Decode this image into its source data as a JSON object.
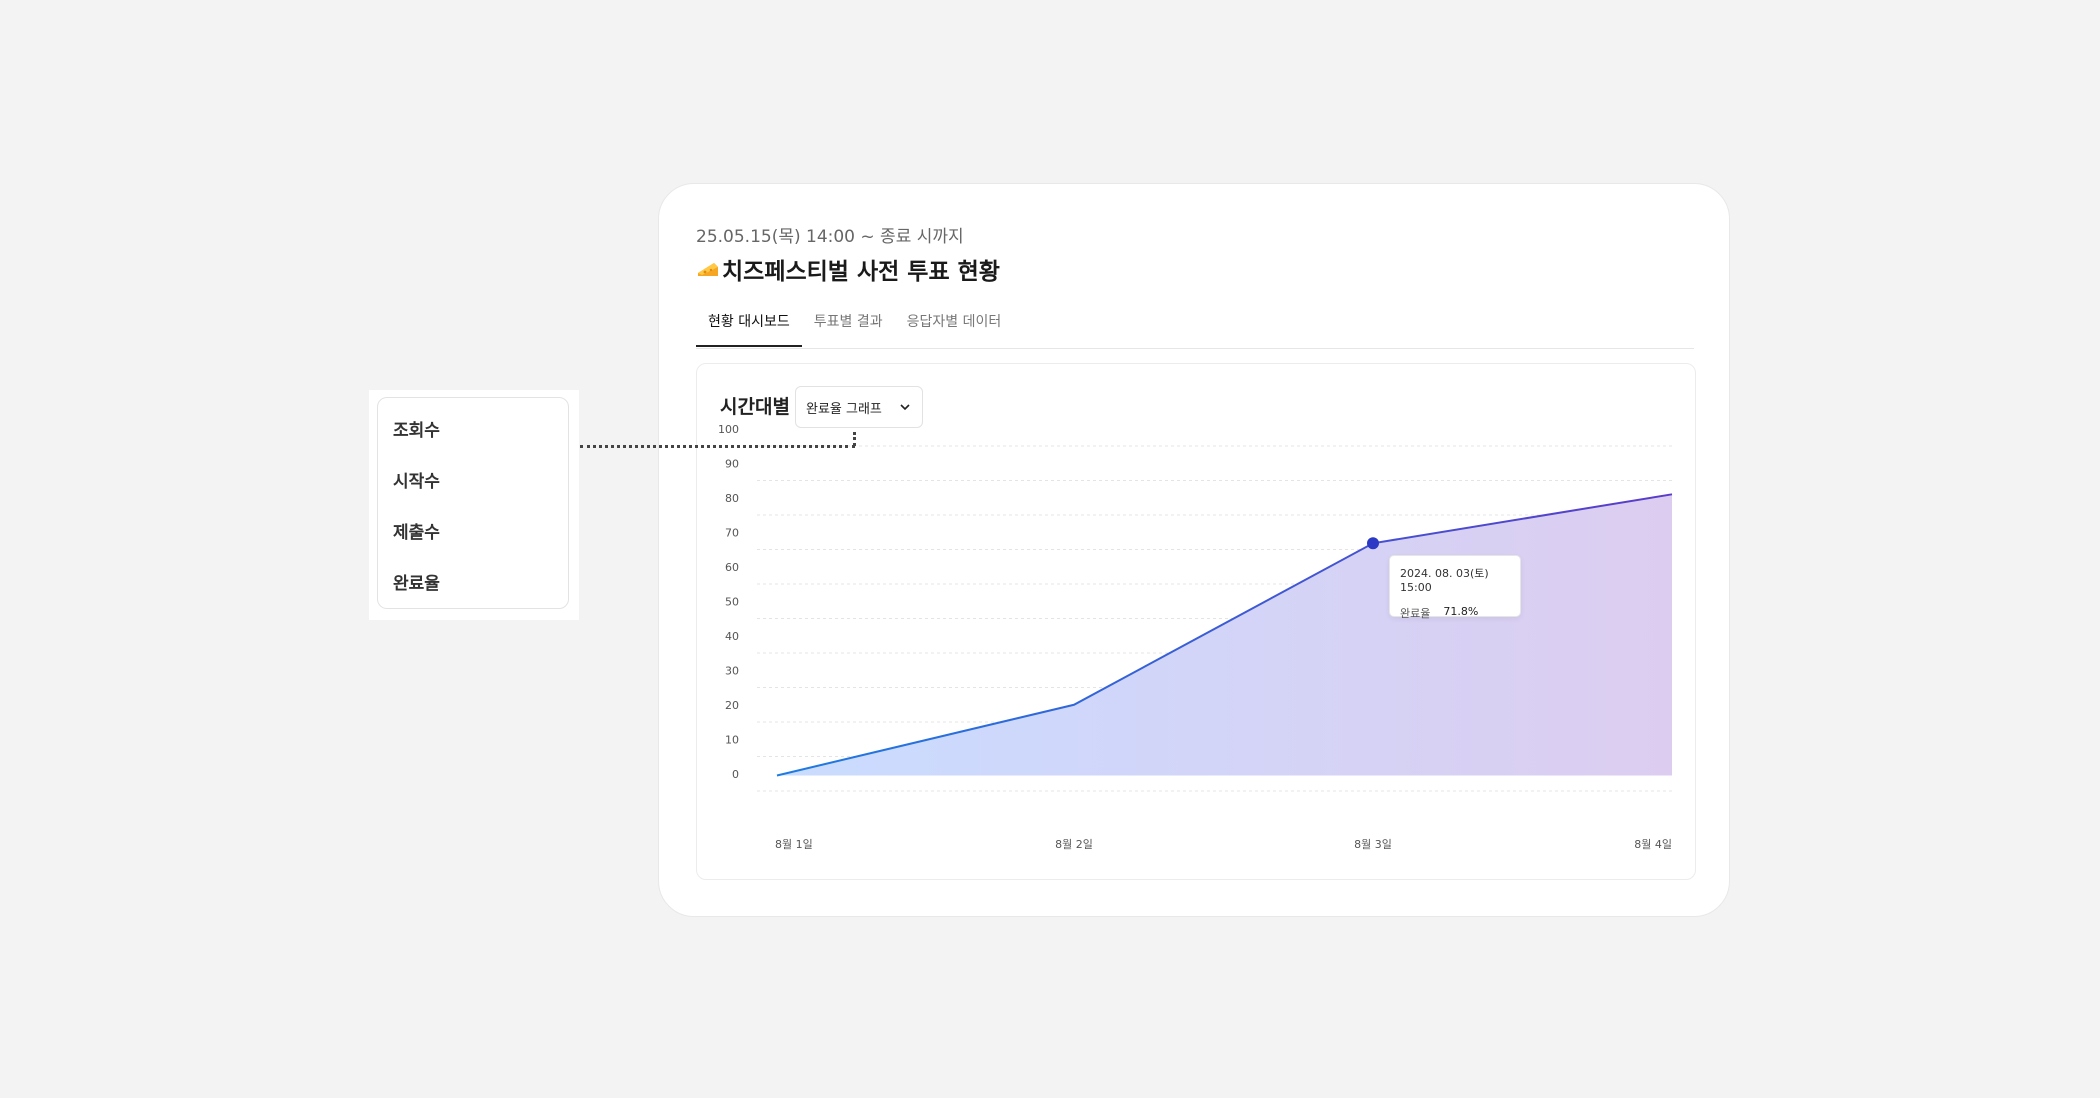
{
  "header": {
    "date_range": "25.05.15(목) 14:00 ~ 종료 시까지",
    "title": "치즈페스티벌 사전 투표 현황",
    "title_icon": "cheese-icon"
  },
  "tabs": [
    {
      "label": "현황 대시보드",
      "active": true
    },
    {
      "label": "투표별 결과",
      "active": false
    },
    {
      "label": "응답자별 데이터",
      "active": false
    }
  ],
  "panel": {
    "title": "시간대별",
    "dropdown": {
      "selected": "완료율 그래프"
    }
  },
  "dropdown_options": [
    "조회수",
    "시작수",
    "제출수",
    "완료율"
  ],
  "tooltip": {
    "datetime": "2024. 08. 03(토) 15:00",
    "label": "완료율",
    "value": "71.8%"
  },
  "colors": {
    "line_start": "#1e7be0",
    "line_end": "#5a3cc8",
    "area_start": "#c9dcff",
    "area_end": "#dccdf0",
    "point": "#2b39c4"
  },
  "chart_data": {
    "type": "area",
    "x": [
      "8월 1일",
      "8월 2일",
      "8월 3일",
      "8월 4일"
    ],
    "series": [
      {
        "values": [
          4.5,
          25,
          71.8,
          86
        ]
      }
    ],
    "ylim": [
      0,
      100
    ],
    "yticks": [
      0,
      10,
      20,
      30,
      40,
      50,
      60,
      70,
      80,
      90,
      100
    ],
    "grid": true,
    "highlight_index": 2
  }
}
